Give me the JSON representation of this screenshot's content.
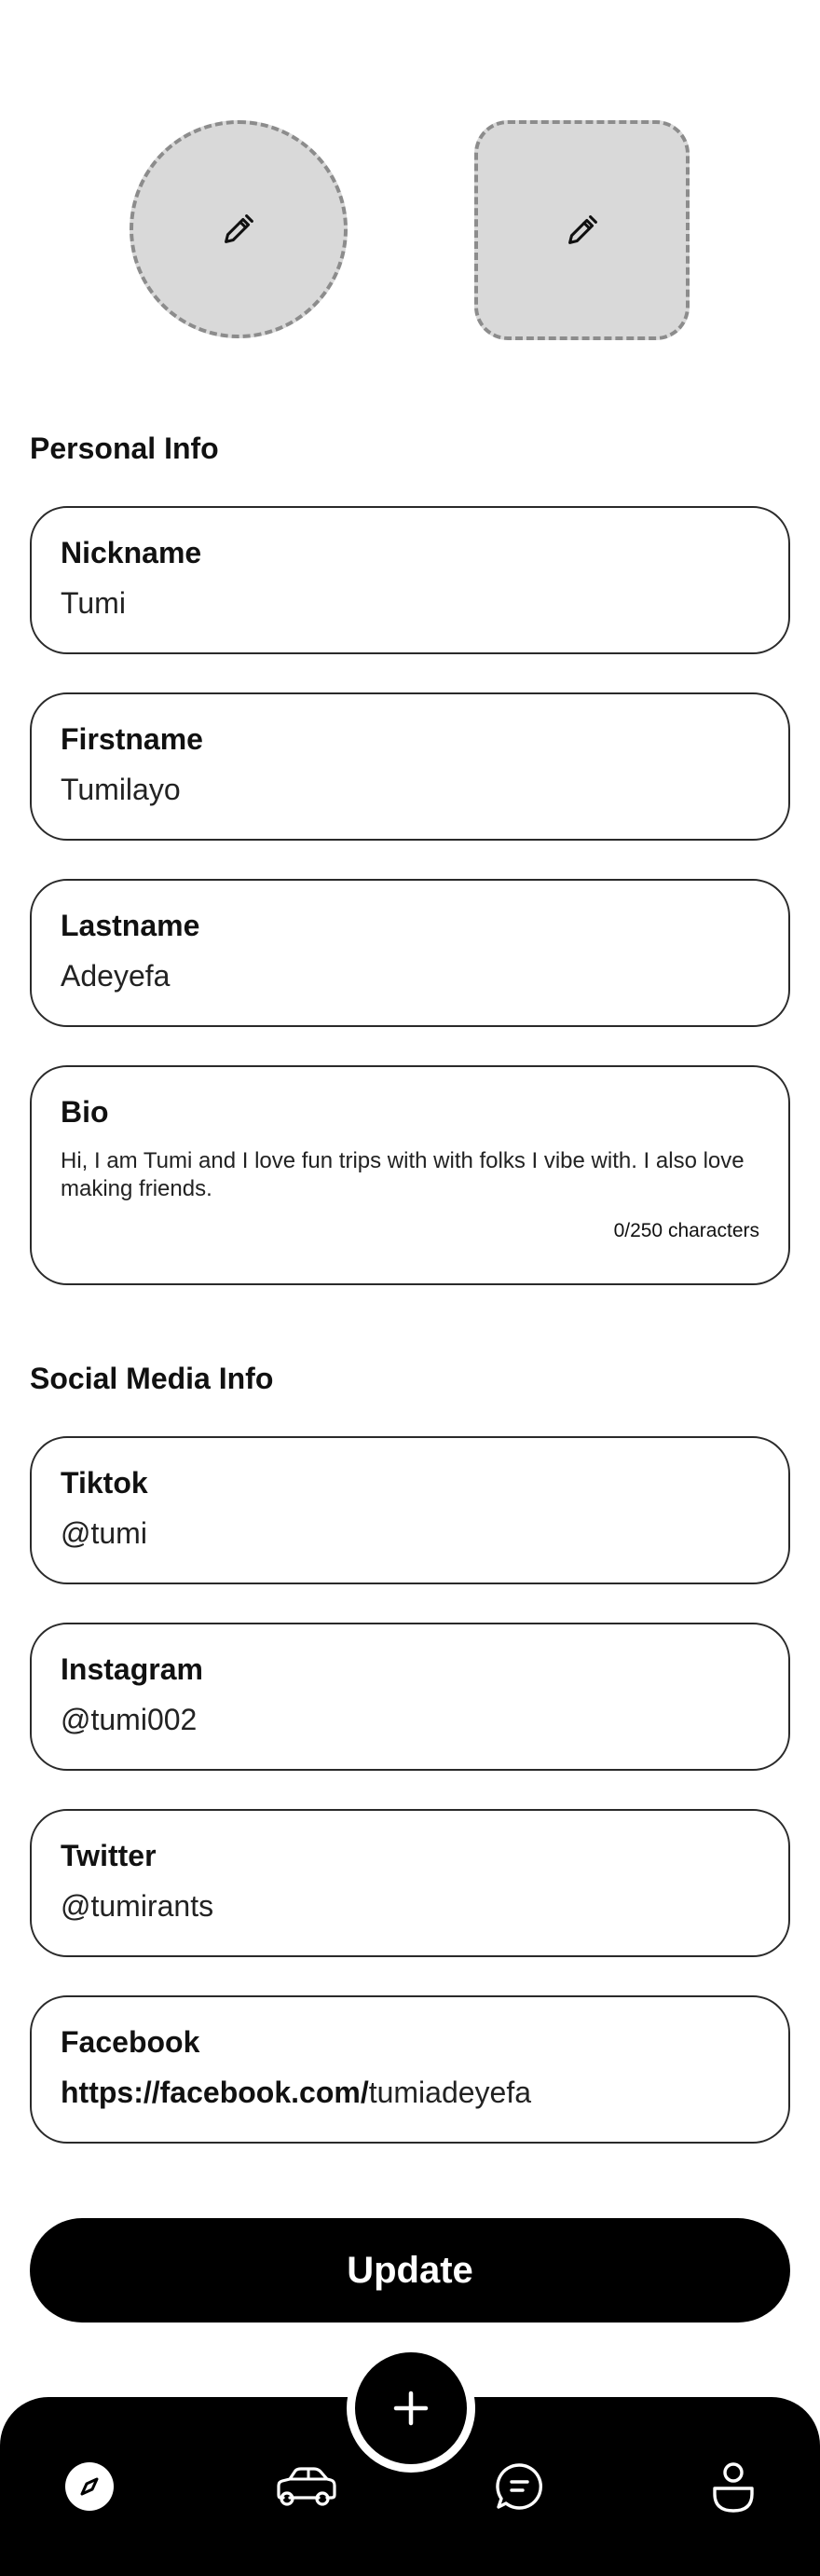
{
  "media": {
    "profile_photo_icon": "pencil-icon",
    "cover_photo_icon": "pencil-icon"
  },
  "personal_info": {
    "title": "Personal Info",
    "nickname": {
      "label": "Nickname",
      "value": "Tumi"
    },
    "firstname": {
      "label": "Firstname",
      "value": "Tumilayo"
    },
    "lastname": {
      "label": "Lastname",
      "value": "Adeyefa"
    },
    "bio": {
      "label": "Bio",
      "value": "Hi,  I am Tumi and I love fun trips with with folks I vibe with. I also love making friends.",
      "counter": "0/250 characters"
    }
  },
  "social_info": {
    "title": "Social Media Info",
    "tiktok": {
      "label": "Tiktok",
      "value": "@tumi"
    },
    "instagram": {
      "label": "Instagram",
      "value": "@tumi002"
    },
    "twitter": {
      "label": "Twitter",
      "value": "@tumirants"
    },
    "facebook": {
      "label": "Facebook",
      "prefix": "https://facebook.com/",
      "value": "tumiadeyefa"
    }
  },
  "actions": {
    "update_label": "Update"
  },
  "nav": {
    "fab_icon": "plus-icon",
    "items": [
      "compass-icon",
      "car-icon",
      "chat-icon",
      "profile-icon"
    ]
  },
  "colors": {
    "primary": "#000000",
    "placeholder_fill": "#d9d9d9",
    "dashed_border": "#8c8c8c",
    "background": "#ffffff"
  }
}
